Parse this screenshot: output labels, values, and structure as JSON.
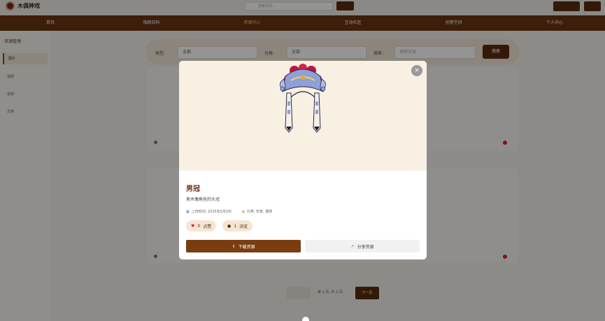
{
  "header": {
    "logo_text": "木偶神戏",
    "search_placeholder": "搜索资源..."
  },
  "nav": {
    "items": [
      "首页",
      "戏剧百科",
      "资源中心",
      "互动社区",
      "创意空间",
      "个人中心"
    ],
    "active": 2
  },
  "sidebar": {
    "title": "资源管理",
    "items": [
      "图片",
      "视频",
      "音频",
      "文档"
    ],
    "active": 0
  },
  "filter": {
    "type_label": "类型:",
    "type_value": "全部",
    "cat_label": "分类:",
    "cat_value": "全部",
    "search_label": "搜索:",
    "search_placeholder": "搜索资源",
    "search_button": "搜索"
  },
  "pagination": {
    "info": "第 1 页, 共 2 页",
    "next": "下一页"
  },
  "modal": {
    "title": "男冠",
    "description": "男木偶角色的头冠",
    "upload_label": "上传时间: 2025年5月9日",
    "category_label": "分类: 形象, 服饰",
    "likes_count": "0",
    "likes_label": "点赞",
    "views_count": "1",
    "views_label": "浏览",
    "download_label": "下载资源",
    "share_label": "分享资源",
    "close_symbol": "×"
  },
  "colors": {
    "brand": "#6a3514",
    "accent": "#f3c86a",
    "heart": "#d22"
  }
}
